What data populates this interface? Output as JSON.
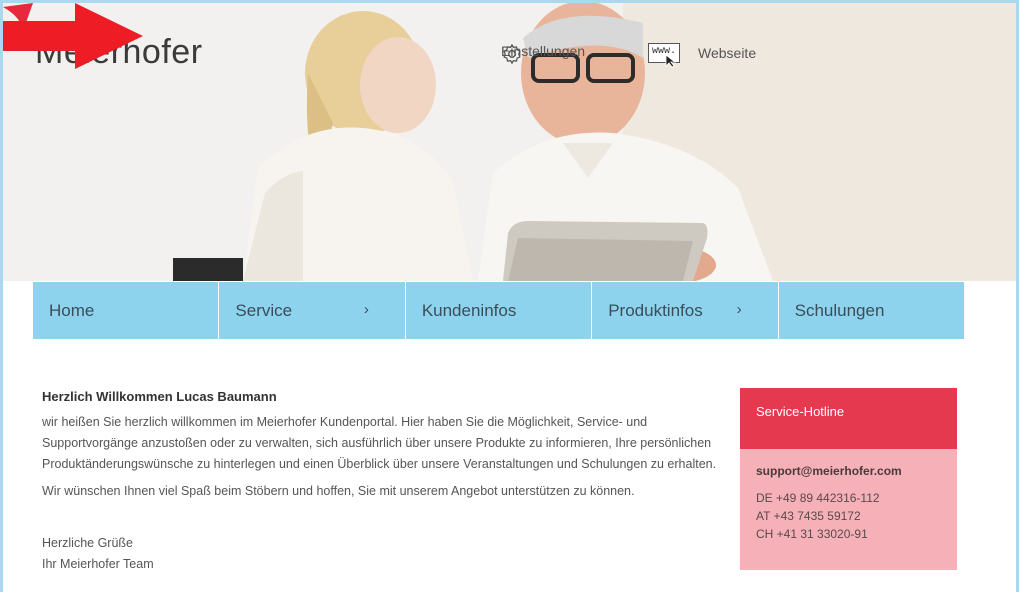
{
  "brand": {
    "name": "Meierhofer",
    "accent": "#e8283c"
  },
  "topnav": {
    "settings": {
      "label": "Einstellungen",
      "icon": "gear-icon"
    },
    "website": {
      "label": "Webseite",
      "icon": "www-cursor-icon",
      "icon_text": "www."
    }
  },
  "mainnav": {
    "items": [
      {
        "label": "Home"
      },
      {
        "label": "Service",
        "chevron": "›"
      },
      {
        "label": "Kundeninfos"
      },
      {
        "label": "Produktinfos",
        "chevron": "›"
      },
      {
        "label": "Schulungen"
      }
    ]
  },
  "content": {
    "title": "Herzlich Willkommen Lucas  Baumann",
    "paragraph1": "wir heißen Sie herzlich willkommen im Meierhofer Kundenportal. Hier haben Sie die Möglichkeit, Service- und Supportvorgänge anzustoßen oder zu verwalten, sich ausführlich über unsere Produkte zu informieren, Ihre persönlichen Produktänderungswünsche zu hinterlegen und einen Überblick über unsere Veranstaltungen und Schulungen zu erhalten.",
    "paragraph2": "Wir wünschen Ihnen viel Spaß beim Stöbern und hoffen, Sie mit unserem Angebot unterstützen zu können.",
    "greeting1": "Herzliche Grüße",
    "greeting2": "Ihr Meierhofer Team"
  },
  "hotline": {
    "title": "Service-Hotline",
    "email": "support@meierhofer.com",
    "phones": [
      "DE +49 89 442316-112",
      "AT +43 7435 59172",
      "CH +41 31 33020-91"
    ]
  },
  "colors": {
    "nav_bg": "#8ed3ee",
    "hotline_head": "#e5394f",
    "hotline_body": "#f6b0b8",
    "frame": "#a9d8ef"
  }
}
